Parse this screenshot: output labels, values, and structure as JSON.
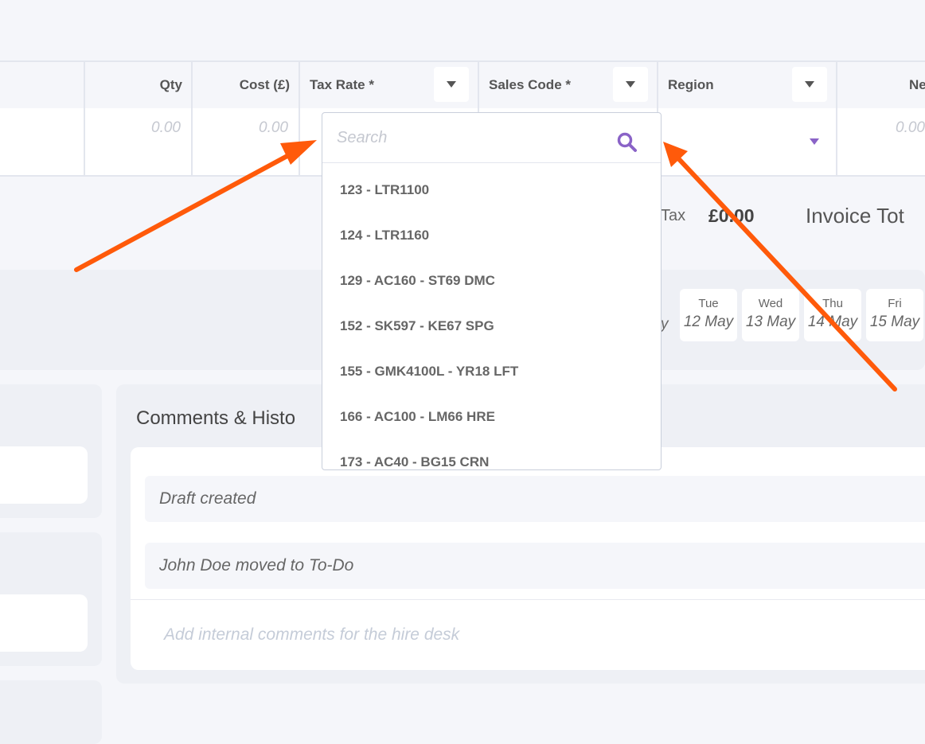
{
  "table": {
    "headers": {
      "qty": "Qty",
      "cost": "Cost (£)",
      "tax_rate": "Tax Rate *",
      "sales_code": "Sales Code *",
      "region": "Region",
      "net": "Ne"
    },
    "row": {
      "qty": "0.00",
      "cost": "0.00",
      "net": "0.00"
    }
  },
  "totals": {
    "tax_label": "Tax",
    "tax_value": "£0.00",
    "invoice_total_label": "Invoice Tot"
  },
  "calendar": {
    "partial_day": "y",
    "days": [
      {
        "name": "Tue",
        "date": "12 May"
      },
      {
        "name": "Wed",
        "date": "13 May"
      },
      {
        "name": "Thu",
        "date": "14 May"
      },
      {
        "name": "Fri",
        "date": "15 May"
      }
    ]
  },
  "comments": {
    "title": "Comments & Histo",
    "history": [
      "Draft created",
      "John Doe moved to To-Do"
    ],
    "placeholder": "Add internal comments for the hire desk"
  },
  "dropdown": {
    "search_placeholder": "Search",
    "options": [
      "123 - LTR1100",
      "124 - LTR1160",
      "129 - AC160 - ST69 DMC",
      "152 - SK597 - KE67 SPG",
      "155 - GMK4100L - YR18 LFT",
      "166 - AC100 - LM66 HRE",
      "173 - AC40 - BG15 CRN"
    ]
  },
  "colors": {
    "accent": "#8a63c7",
    "arrow": "#ff5a0a"
  }
}
